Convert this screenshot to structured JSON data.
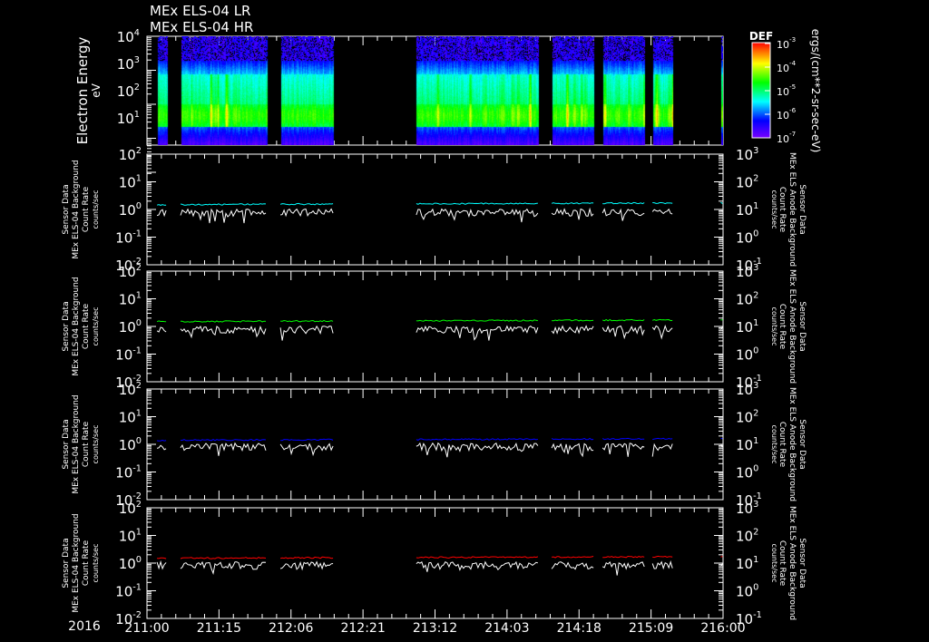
{
  "title_lines": [
    "MEx ELS-04 LR",
    "MEx ELS-04 HR"
  ],
  "colors": {
    "background": "#000000",
    "axes": "#ffffff",
    "panel_series": [
      "#00ffff",
      "#00ff00",
      "#0000ff",
      "#ff0000"
    ],
    "second_series": "#ffffff"
  },
  "chart_data": [
    {
      "type": "heatmap",
      "ylabel": "Electron Energy",
      "yunit": "eV",
      "yscale": "log",
      "ylim": [
        1,
        10000
      ],
      "yticks": [
        "10^1",
        "10^2",
        "10^3",
        "10^4"
      ],
      "colorbar": {
        "title": "DEF",
        "unit": "ergs/(cm**2-sr-sec-eV)",
        "scale": "log",
        "range": [
          1e-07,
          0.001
        ],
        "ticks": [
          "10^-3",
          "10^-4",
          "10^-5",
          "10^-6",
          "10^-7"
        ],
        "colormap": "rainbow"
      },
      "data_segments_hours": [
        [
          2.1,
          4.3
        ],
        [
          7.0,
          25.0
        ],
        [
          27.8,
          38.8
        ],
        [
          56.1,
          81.5
        ],
        [
          84.3,
          93.0
        ],
        [
          94.9,
          103.6
        ],
        [
          105.3,
          109.6
        ],
        [
          119.5,
          120.0
        ]
      ]
    },
    {
      "type": "line",
      "panel": 1,
      "left_label": [
        "Sensor Data",
        "MEx ELS-04 Background",
        "Count Rate",
        "counts/sec"
      ],
      "right_label": [
        "Sensor Data",
        "MEx ELS Anode Background",
        "Count Rate",
        "counts/sec"
      ],
      "yscale": "log",
      "ylim_left": [
        0.01,
        100
      ],
      "ylim_right": [
        0.1,
        1000
      ],
      "series": [
        {
          "color": "#00ffff",
          "level": 1.5
        },
        {
          "color": "#ffffff",
          "level": 0.8
        }
      ]
    },
    {
      "type": "line",
      "panel": 2,
      "left_label": [
        "Sensor Data",
        "MEx ELS-04 Background",
        "Count Rate",
        "counts/sec"
      ],
      "right_label": [
        "Sensor Data",
        "MEx ELS Anode Background",
        "Count Rate",
        "counts/sec"
      ],
      "yscale": "log",
      "ylim_left": [
        0.01,
        100
      ],
      "ylim_right": [
        0.1,
        1000
      ],
      "series": [
        {
          "color": "#00ff00",
          "level": 1.5
        },
        {
          "color": "#ffffff",
          "level": 0.8
        }
      ]
    },
    {
      "type": "line",
      "panel": 3,
      "left_label": [
        "Sensor Data",
        "MEx ELS-04 Background",
        "Count Rate",
        "counts/sec"
      ],
      "right_label": [
        "Sensor Data",
        "MEx ELS Anode Background",
        "Count Rate",
        "counts/sec"
      ],
      "yscale": "log",
      "ylim_left": [
        0.01,
        100
      ],
      "ylim_right": [
        0.1,
        1000
      ],
      "series": [
        {
          "color": "#0000ff",
          "level": 1.4
        },
        {
          "color": "#ffffff",
          "level": 0.85
        }
      ]
    },
    {
      "type": "line",
      "panel": 4,
      "left_label": [
        "Sensor Data",
        "MEx ELS-04 Background",
        "Count Rate",
        "counts/sec"
      ],
      "right_label": [
        "Sensor Data",
        "MEx ELS Anode Background",
        "Count Rate",
        "counts/sec"
      ],
      "yscale": "log",
      "ylim_left": [
        0.01,
        100
      ],
      "ylim_right": [
        0.1,
        1000
      ],
      "series": [
        {
          "color": "#ff0000",
          "level": 1.5
        },
        {
          "color": "#ffffff",
          "level": 0.85
        }
      ]
    }
  ],
  "xaxis": {
    "year": "2016",
    "ticks": [
      "211:00",
      "211:15",
      "212:06",
      "212:21",
      "213:12",
      "214:03",
      "214:18",
      "215:09",
      "216:00"
    ],
    "range_hours": [
      0,
      120
    ]
  }
}
